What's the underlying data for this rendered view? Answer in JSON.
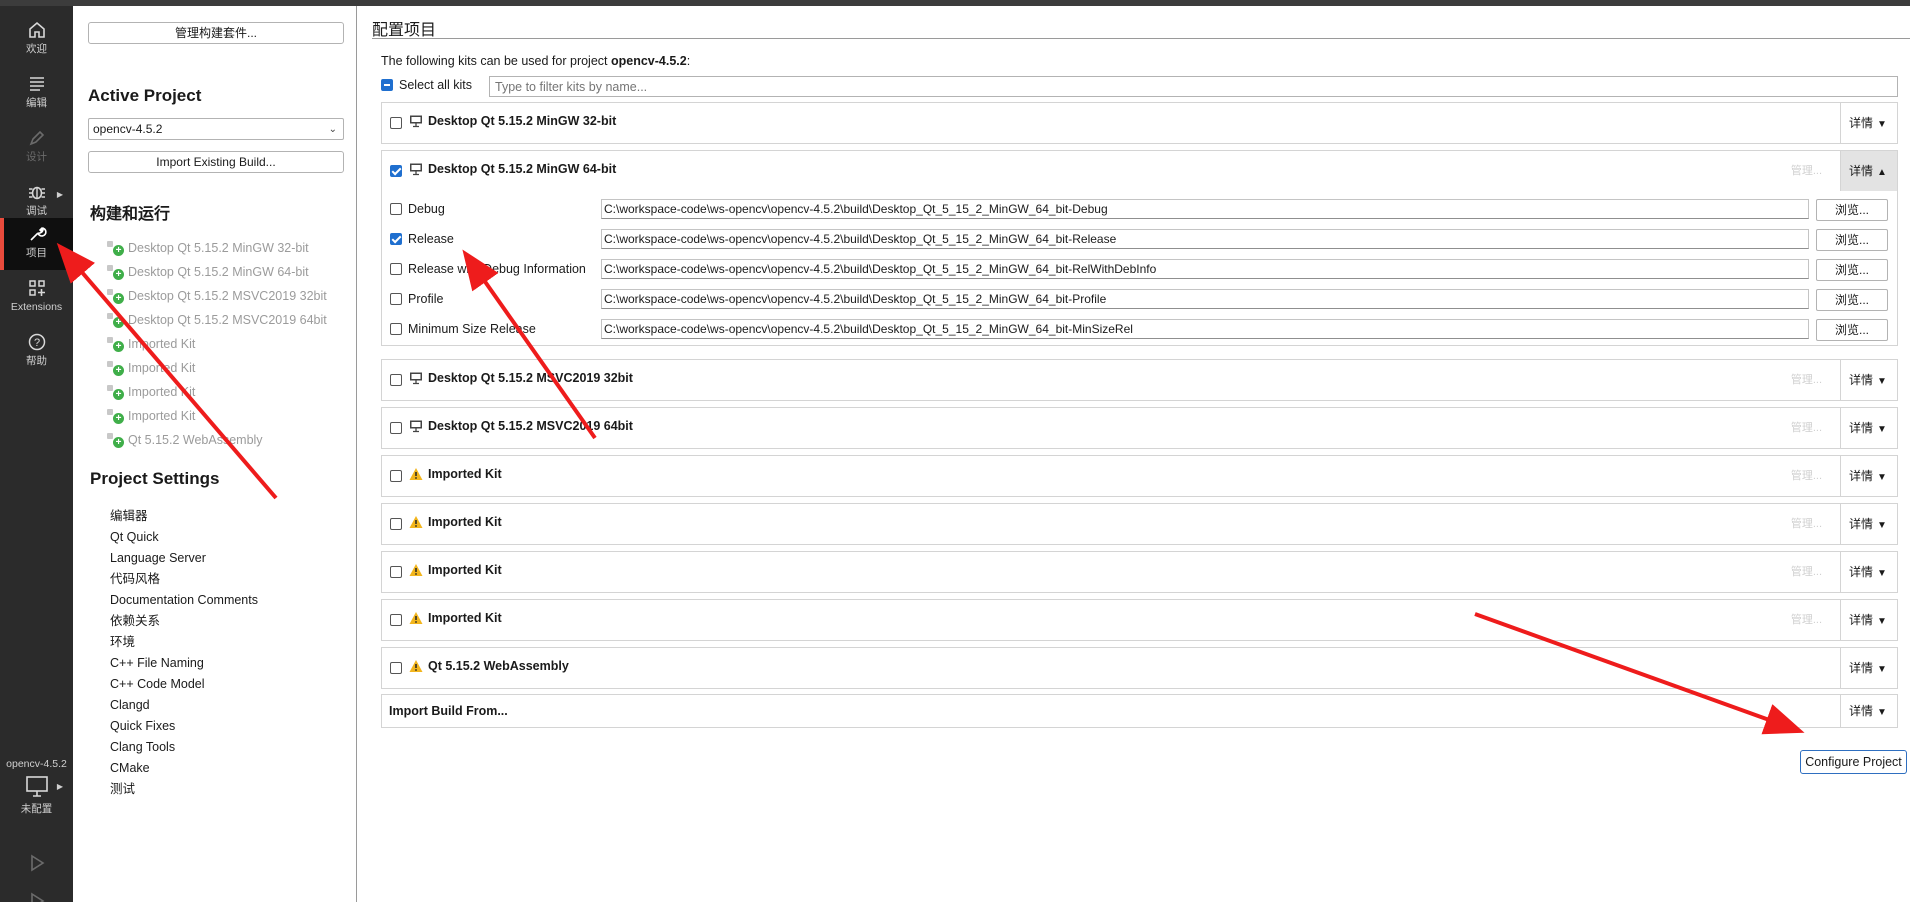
{
  "modebar": {
    "items": [
      {
        "label": "欢迎",
        "icon": "home-icon"
      },
      {
        "label": "编辑",
        "icon": "edit-lines-icon"
      },
      {
        "label": "设计",
        "icon": "pen-icon"
      },
      {
        "label": "调试",
        "icon": "bug-icon"
      },
      {
        "label": "项目",
        "icon": "wrench-icon"
      },
      {
        "label": "Extensions",
        "icon": "extensions-icon"
      },
      {
        "label": "帮助",
        "icon": "help-icon"
      }
    ],
    "kit_selector": {
      "project": "opencv-4.5.2",
      "config": "未配置"
    }
  },
  "sidebar": {
    "manage_kits_button": "管理构建套件...",
    "active_project_heading": "Active Project",
    "project_combo": "opencv-4.5.2",
    "import_existing_button": "Import Existing Build...",
    "build_run_heading": "构建和运行",
    "kits": [
      "Desktop Qt 5.15.2 MinGW 32-bit",
      "Desktop Qt 5.15.2 MinGW 64-bit",
      "Desktop Qt 5.15.2 MSVC2019 32bit",
      "Desktop Qt 5.15.2 MSVC2019 64bit",
      "Imported Kit",
      "Imported Kit",
      "Imported Kit",
      "Imported Kit",
      "Qt 5.15.2 WebAssembly"
    ],
    "project_settings_heading": "Project Settings",
    "settings": [
      "编辑器",
      "Qt Quick",
      "Language Server",
      "代码风格",
      "Documentation Comments",
      "依赖关系",
      "环境",
      "C++ File Naming",
      "C++ Code Model",
      "Clangd",
      "Quick Fixes",
      "Clang Tools",
      "CMake",
      "测试"
    ]
  },
  "main": {
    "title": "配置项目",
    "intro_prefix": "The following kits can be used for project ",
    "intro_project": "opencv-4.5.2",
    "intro_suffix": ":",
    "select_all_label": "Select all kits",
    "filter_placeholder": "Type to filter kits by name...",
    "manage_label": "管理...",
    "details_label": "详情",
    "browse_label": "浏览...",
    "kits": [
      {
        "name": "Desktop Qt 5.15.2 MinGW 32-bit",
        "checked": false,
        "icon": "monitor-icon"
      },
      {
        "name": "Desktop Qt 5.15.2 MinGW 64-bit",
        "checked": true,
        "icon": "monitor-icon",
        "expanded": true
      },
      {
        "name": "Desktop Qt 5.15.2 MSVC2019 32bit",
        "checked": false,
        "icon": "monitor-icon"
      },
      {
        "name": "Desktop Qt 5.15.2 MSVC2019 64bit",
        "checked": false,
        "icon": "monitor-icon"
      },
      {
        "name": "Imported Kit",
        "checked": false,
        "icon": "warning-icon"
      },
      {
        "name": "Imported Kit",
        "checked": false,
        "icon": "warning-icon"
      },
      {
        "name": "Imported Kit",
        "checked": false,
        "icon": "warning-icon"
      },
      {
        "name": "Imported Kit",
        "checked": false,
        "icon": "warning-icon"
      },
      {
        "name": "Qt 5.15.2 WebAssembly",
        "checked": false,
        "icon": "warning-icon"
      }
    ],
    "build_configs": [
      {
        "label": "Debug",
        "checked": false,
        "path": "C:\\workspace-code\\ws-opencv\\opencv-4.5.2\\build\\Desktop_Qt_5_15_2_MinGW_64_bit-Debug"
      },
      {
        "label": "Release",
        "checked": true,
        "path": "C:\\workspace-code\\ws-opencv\\opencv-4.5.2\\build\\Desktop_Qt_5_15_2_MinGW_64_bit-Release"
      },
      {
        "label": "Release with Debug Information",
        "checked": false,
        "path": "C:\\workspace-code\\ws-opencv\\opencv-4.5.2\\build\\Desktop_Qt_5_15_2_MinGW_64_bit-RelWithDebInfo"
      },
      {
        "label": "Profile",
        "checked": false,
        "path": "C:\\workspace-code\\ws-opencv\\opencv-4.5.2\\build\\Desktop_Qt_5_15_2_MinGW_64_bit-Profile"
      },
      {
        "label": "Minimum Size Release",
        "checked": false,
        "path": "C:\\workspace-code\\ws-opencv\\opencv-4.5.2\\build\\Desktop_Qt_5_15_2_MinGW_64_bit-MinSizeRel"
      }
    ],
    "import_build_label": "Import Build From...",
    "configure_button": "Configure Project"
  },
  "colors": {
    "modebar_bg": "#2b2b2b",
    "accent_blue": "#1f6fcf",
    "annotation_red": "#ee1c1c",
    "warning_yellow": "#f2b51d",
    "plus_green": "#3fae49"
  }
}
